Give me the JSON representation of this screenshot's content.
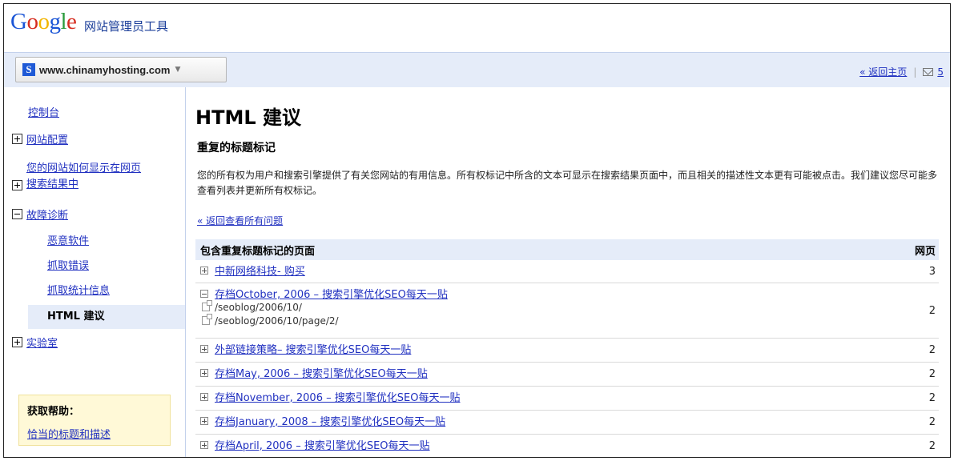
{
  "header": {
    "logo": "Google",
    "product_name": "网站管理员工具"
  },
  "sitebar": {
    "site_icon": "S",
    "site_url": "www.chinamyhosting.com",
    "back_home": "« 返回主页",
    "message_count": "5"
  },
  "sidebar": {
    "dashboard": "控制台",
    "site_config": "网站配置",
    "search_appearance_line1": "您的网站如何显示在网页",
    "search_appearance_line2": "搜索结果中",
    "diagnostics": "故障诊断",
    "malware": "恶意软件",
    "crawl_errors": "抓取错误",
    "crawl_stats": "抓取统计信息",
    "html_suggestions": "HTML 建议",
    "labs": "实验室",
    "help_title": "获取帮助：",
    "help_link": "恰当的标题和描述"
  },
  "main": {
    "title": "HTML 建议",
    "subtitle": "重复的标题标记",
    "description": "您的所有权为用户和搜索引擎提供了有关您网站的有用信息。所有权标记中所含的文本可显示在搜索结果页面中，而且相关的描述性文本更有可能被点击。我们建议您尽可能多查看列表并更新所有权标记。",
    "back_link": "« 返回查看所有问题",
    "table": {
      "col_title": "包含重复标题标记的页面",
      "col_count": "网页",
      "rows": [
        {
          "title": "中新网络科技- 购买",
          "count": "3"
        },
        {
          "title": "存档October, 2006 – 搜索引擎优化SEO每天一贴",
          "count": "2",
          "urls": [
            "/seoblog/2006/10/",
            "/seoblog/2006/10/page/2/"
          ]
        },
        {
          "title": "外部链接策略– 搜索引擎优化SEO每天一贴",
          "count": "2"
        },
        {
          "title": "存档May, 2006 – 搜索引擎优化SEO每天一贴",
          "count": "2"
        },
        {
          "title": "存档November, 2006 – 搜索引擎优化SEO每天一贴",
          "count": "2"
        },
        {
          "title": "存档January, 2008 – 搜索引擎优化SEO每天一贴",
          "count": "2"
        },
        {
          "title": "存档April, 2006 – 搜索引擎优化SEO每天一贴",
          "count": "2"
        }
      ]
    }
  },
  "colors": {
    "link": "#2030c0",
    "header_bg": "#e5ecf9",
    "help_bg": "#fff9d7"
  }
}
